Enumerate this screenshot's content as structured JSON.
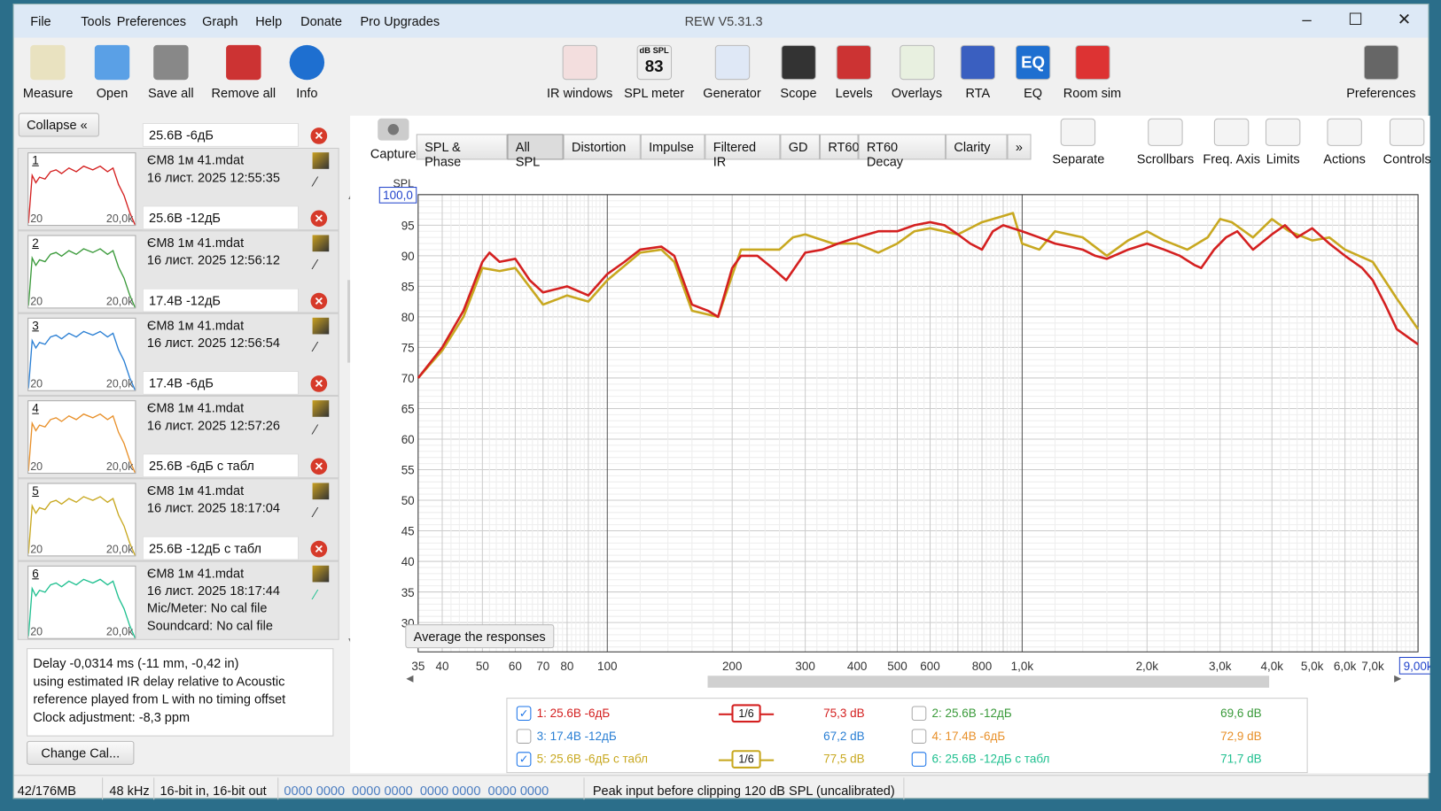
{
  "window": {
    "title": "REW V5.31.3",
    "min": "–",
    "max": "☐",
    "close": "✕"
  },
  "menu": [
    "File",
    "Tools",
    "Preferences",
    "Graph",
    "Help",
    "Donate",
    "Pro Upgrades"
  ],
  "toolbar_left": [
    {
      "label": "Measure",
      "icon": "measure-icon"
    },
    {
      "label": "Open",
      "icon": "folder-icon"
    },
    {
      "label": "Save all",
      "icon": "save-icon"
    },
    {
      "label": "Remove all",
      "icon": "remove-icon"
    },
    {
      "label": "Info",
      "icon": "info-icon"
    }
  ],
  "toolbar_right": [
    {
      "label": "IR windows"
    },
    {
      "label": "SPL meter",
      "badge": "83",
      "badge_top": "dB SPL"
    },
    {
      "label": "Generator"
    },
    {
      "label": "Scope"
    },
    {
      "label": "Levels"
    },
    {
      "label": "Overlays"
    },
    {
      "label": "RTA"
    },
    {
      "label": "EQ",
      "badge": "EQ"
    },
    {
      "label": "Room sim"
    },
    {
      "label": "Preferences"
    }
  ],
  "graph_tools": [
    "Separate",
    "Scrollbars",
    "Freq. Axis",
    "Limits",
    "Actions",
    "Controls"
  ],
  "capture_label": "Capture",
  "tabs": [
    "SPL & Phase",
    "All SPL",
    "Distortion",
    "Impulse",
    "Filtered IR",
    "GD",
    "RT60",
    "RT60 Decay",
    "Clarity",
    "»"
  ],
  "selected_tab": "All SPL",
  "collapse_label": "Collapse «",
  "measurements": [
    {
      "num": "1",
      "name": "25.6В -6дБ",
      "file": "ЄМ8 1м 41.mdat",
      "date": "16 лист. 2025 12:55:35",
      "color": "#d42020"
    },
    {
      "num": "2",
      "name": "25.6В -12дБ",
      "file": "ЄМ8 1м 41.mdat",
      "date": "16 лист. 2025 12:56:12",
      "color": "#3a9a3a"
    },
    {
      "num": "3",
      "name": "17.4В -12дБ",
      "file": "ЄМ8 1м 41.mdat",
      "date": "16 лист. 2025 12:56:54",
      "color": "#2a7fd4"
    },
    {
      "num": "4",
      "name": "17.4В -6дБ",
      "file": "ЄМ8 1м 41.mdat",
      "date": "16 лист. 2025 12:57:26",
      "color": "#e8902a"
    },
    {
      "num": "5",
      "name": "25.6В -6дБ с табл",
      "file": "ЄМ8 1м 41.mdat",
      "date": "16 лист. 2025 18:17:04",
      "color": "#c8a820"
    },
    {
      "num": "6",
      "name": "25.6В -12дБ с табл",
      "file": "ЄМ8 1м 41.mdat",
      "date": "16 лист. 2025 18:17:44",
      "color": "#20c090",
      "mic": "Mic/Meter: No cal file",
      "soundcard": "Soundcard: No cal file"
    }
  ],
  "thumb_axis": {
    "left": "20",
    "right": "20,0k"
  },
  "info_text": [
    "Delay -0,0314 ms (-11 mm, -0,42 in)",
    "using estimated IR delay relative to Acoustic",
    "reference played from  L with no timing offset",
    "Clock adjustment: -8,3 ppm"
  ],
  "change_cal_label": "Change Cal...",
  "average_label": "Average the responses",
  "legend": [
    {
      "label": "1: 25.6В -6дБ",
      "value": "75,3 dB",
      "checked": true,
      "smoothing": "1/6",
      "color": "#d42020"
    },
    {
      "label": "2: 25.6В -12дБ",
      "value": "69,6 dB",
      "checked": false,
      "color": "#3a9a3a"
    },
    {
      "label": "3: 17.4В -12дБ",
      "value": "67,2 dB",
      "checked": false,
      "color": "#2a7fd4"
    },
    {
      "label": "4: 17.4В -6дБ",
      "value": "72,9 dB",
      "checked": false,
      "color": "#e8902a"
    },
    {
      "label": "5: 25.6В -6дБ с табл",
      "value": "77,5 dB",
      "checked": true,
      "smoothing": "1/6",
      "color": "#c8a820"
    },
    {
      "label": "6: 25.6В -12дБ с табл",
      "value": "71,7 dB",
      "checked": false,
      "color": "#20c090"
    }
  ],
  "status": {
    "memory": "42/176MB",
    "rate": "48 kHz",
    "bits": "16-bit in, 16-bit out",
    "hex": "0000 0000  0000 0000  0000 0000  0000 0000",
    "peak": "Peak input before clipping 120 dB SPL (uncalibrated)"
  },
  "chart_data": {
    "type": "line",
    "ylabel": "SPL",
    "xscale": "log",
    "xlim": [
      35,
      9000
    ],
    "ylim": [
      30,
      100
    ],
    "grid": true,
    "ymax_label": "100,0",
    "xmax_label": "9,00k",
    "yticks": [
      30,
      35,
      40,
      45,
      50,
      55,
      60,
      65,
      70,
      75,
      80,
      85,
      90,
      95
    ],
    "xticks": [
      {
        "v": 35,
        "l": "35"
      },
      {
        "v": 40,
        "l": "40"
      },
      {
        "v": 50,
        "l": "50"
      },
      {
        "v": 60,
        "l": "60"
      },
      {
        "v": 70,
        "l": "70"
      },
      {
        "v": 80,
        "l": "80"
      },
      {
        "v": 100,
        "l": "100"
      },
      {
        "v": 200,
        "l": "200"
      },
      {
        "v": 300,
        "l": "300"
      },
      {
        "v": 400,
        "l": "400"
      },
      {
        "v": 500,
        "l": "500"
      },
      {
        "v": 600,
        "l": "600"
      },
      {
        "v": 800,
        "l": "800"
      },
      {
        "v": 1000,
        "l": "1,0k"
      },
      {
        "v": 2000,
        "l": "2,0k"
      },
      {
        "v": 3000,
        "l": "3,0k"
      },
      {
        "v": 4000,
        "l": "4,0k"
      },
      {
        "v": 5000,
        "l": "5,0k"
      },
      {
        "v": 6000,
        "l": "6,0k"
      },
      {
        "v": 7000,
        "l": "7,0k"
      }
    ],
    "series": [
      {
        "name": "1: 25.6В -6дБ",
        "color": "#d42020",
        "x": [
          35,
          40,
          45,
          50,
          52,
          55,
          60,
          65,
          70,
          80,
          90,
          100,
          110,
          120,
          135,
          145,
          160,
          175,
          185,
          200,
          210,
          230,
          250,
          270,
          300,
          330,
          360,
          400,
          450,
          500,
          550,
          600,
          650,
          700,
          750,
          800,
          850,
          900,
          1000,
          1100,
          1200,
          1300,
          1400,
          1500,
          1600,
          1800,
          2000,
          2200,
          2400,
          2600,
          2700,
          2900,
          3100,
          3300,
          3600,
          4000,
          4300,
          4600,
          5000,
          5500,
          6000,
          6600,
          7000,
          7500,
          8000,
          9000
        ],
        "y": [
          70,
          75,
          81,
          89,
          90.5,
          89,
          89.5,
          86,
          84,
          85,
          83.5,
          87,
          89,
          91,
          91.5,
          90,
          82,
          81,
          80,
          88,
          90,
          90,
          88,
          86,
          90.5,
          91,
          92,
          93,
          94,
          94,
          95,
          95.5,
          95,
          93.5,
          92,
          91,
          94,
          95,
          94,
          93,
          92,
          91.5,
          91,
          90,
          89.5,
          91,
          92,
          91,
          90,
          88.5,
          88,
          91,
          93,
          94,
          91,
          93.5,
          95,
          93,
          94.5,
          92,
          90,
          88,
          86,
          82,
          78,
          75.5
        ]
      },
      {
        "name": "5: 25.6В -6дБ с табл",
        "color": "#c8a820",
        "x": [
          35,
          40,
          45,
          50,
          55,
          60,
          70,
          80,
          90,
          100,
          120,
          135,
          145,
          160,
          185,
          210,
          230,
          260,
          280,
          300,
          350,
          400,
          450,
          500,
          550,
          600,
          700,
          800,
          900,
          950,
          1000,
          1100,
          1200,
          1400,
          1600,
          1800,
          2000,
          2200,
          2500,
          2800,
          3000,
          3200,
          3600,
          4000,
          4400,
          5000,
          5500,
          6000,
          7000,
          8000,
          9000
        ],
        "y": [
          70,
          74.5,
          80,
          88,
          87.5,
          88,
          82,
          83.5,
          82.5,
          86,
          90.5,
          91,
          89,
          81,
          80,
          91,
          91,
          91,
          93,
          93.5,
          92,
          92,
          90.5,
          92,
          94,
          94.5,
          93.5,
          95.5,
          96.5,
          97,
          92,
          91,
          94,
          93,
          90,
          92.5,
          94,
          92.5,
          91,
          93,
          96,
          95.5,
          93,
          96,
          94,
          92.5,
          93,
          91,
          89,
          83,
          78
        ]
      }
    ]
  }
}
